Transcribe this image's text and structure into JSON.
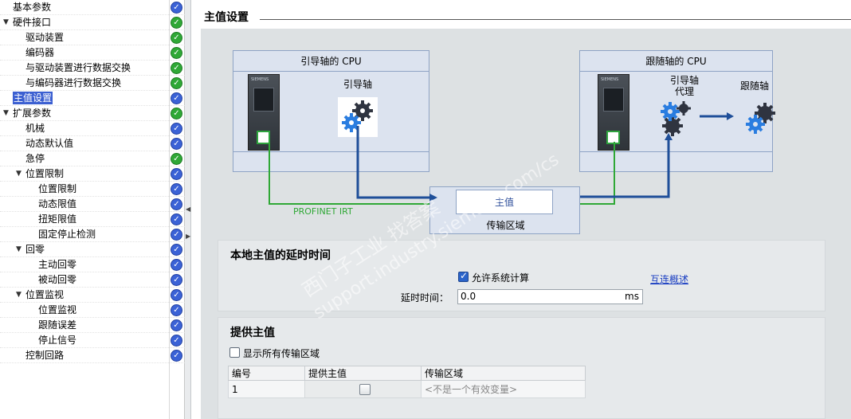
{
  "tree": {
    "items": [
      {
        "label": "基本参数",
        "level": 0,
        "expander": "",
        "status": "blue"
      },
      {
        "label": "硬件接口",
        "level": 0,
        "expander": "▼",
        "status": "green"
      },
      {
        "label": "驱动装置",
        "level": 1,
        "expander": "",
        "status": "green"
      },
      {
        "label": "编码器",
        "level": 1,
        "expander": "",
        "status": "green"
      },
      {
        "label": "与驱动装置进行数据交换",
        "level": 1,
        "expander": "",
        "status": "green"
      },
      {
        "label": "与编码器进行数据交换",
        "level": 1,
        "expander": "",
        "status": "green"
      },
      {
        "label": "主值设置",
        "level": 0,
        "expander": "",
        "status": "blue",
        "selected": true
      },
      {
        "label": "扩展参数",
        "level": 0,
        "expander": "▼",
        "status": "green"
      },
      {
        "label": "机械",
        "level": 1,
        "expander": "",
        "status": "blue"
      },
      {
        "label": "动态默认值",
        "level": 1,
        "expander": "",
        "status": "blue"
      },
      {
        "label": "急停",
        "level": 1,
        "expander": "",
        "status": "green"
      },
      {
        "label": "位置限制",
        "level": 1,
        "expander": "▼",
        "status": "blue"
      },
      {
        "label": "位置限制",
        "level": 2,
        "expander": "",
        "status": "blue"
      },
      {
        "label": "动态限值",
        "level": 2,
        "expander": "",
        "status": "blue"
      },
      {
        "label": "扭矩限值",
        "level": 2,
        "expander": "",
        "status": "blue"
      },
      {
        "label": "固定停止检测",
        "level": 2,
        "expander": "",
        "status": "blue"
      },
      {
        "label": "回零",
        "level": 1,
        "expander": "▼",
        "status": "blue"
      },
      {
        "label": "主动回零",
        "level": 2,
        "expander": "",
        "status": "blue"
      },
      {
        "label": "被动回零",
        "level": 2,
        "expander": "",
        "status": "blue"
      },
      {
        "label": "位置监视",
        "level": 1,
        "expander": "▼",
        "status": "blue"
      },
      {
        "label": "位置监视",
        "level": 2,
        "expander": "",
        "status": "blue"
      },
      {
        "label": "跟随误差",
        "level": 2,
        "expander": "",
        "status": "blue"
      },
      {
        "label": "停止信号",
        "level": 2,
        "expander": "",
        "status": "blue"
      },
      {
        "label": "控制回路",
        "level": 1,
        "expander": "",
        "status": "blue"
      }
    ]
  },
  "colors": {
    "status_green": "#2fa836",
    "status_blue": "#3b62d6",
    "profinet_green": "#2fa836",
    "arrow_blue": "#1f4f99"
  },
  "main": {
    "section_title": "主值设置",
    "diagram": {
      "leading_cpu_title": "引导轴的 CPU",
      "leading_axis_label": "引导轴",
      "following_cpu_title": "跟随轴的 CPU",
      "leading_proxy_label_line1": "引导轴",
      "leading_proxy_label_line2": "代理",
      "following_axis_label": "跟随轴",
      "plc_brand": "SIEMENS",
      "master_value_label": "主值",
      "transfer_area_label": "传输区域",
      "profinet_label": "PROFINET IRT"
    },
    "local_delay_panel": {
      "title": "本地主值的延时时间",
      "allow_system_calc_label": "允许系统计算",
      "allow_system_calc_checked": true,
      "interconnect_link": "互连概述",
      "delay_label": "延时时间：",
      "delay_value": "0.0",
      "delay_unit": "ms"
    },
    "provide_panel": {
      "title": "提供主值",
      "show_all_label": "显示所有传输区域",
      "show_all_checked": false,
      "table": {
        "columns": [
          "编号",
          "提供主值",
          "传输区域"
        ],
        "rows": [
          {
            "number": "1",
            "provide": false,
            "transfer_area": "<不是一个有效变量>"
          }
        ]
      }
    }
  },
  "watermark": {
    "line1": "西门子工业 找答案",
    "line2": "support.industry.siemens.com/cs"
  }
}
